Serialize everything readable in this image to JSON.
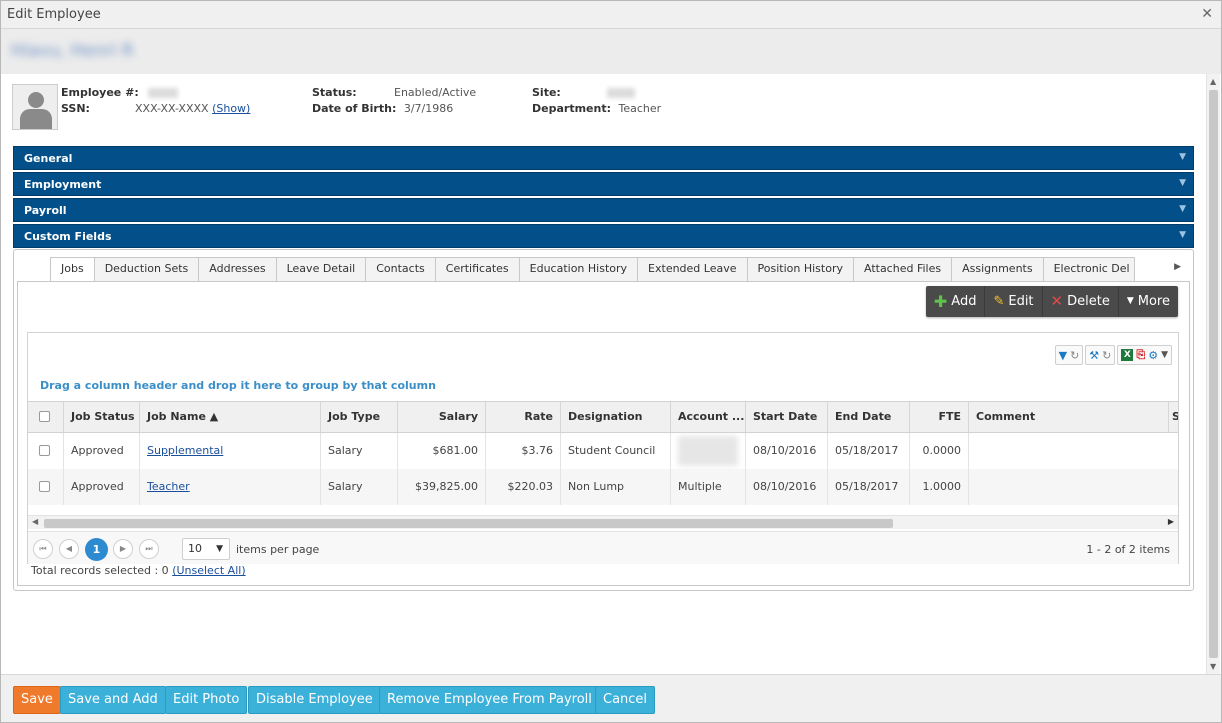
{
  "window": {
    "title": "Edit Employee",
    "employee_name": "Hiavu, Henri R"
  },
  "header": {
    "employee_num_label": "Employee #:",
    "ssn_label": "SSN:",
    "ssn_value": "XXX-XX-XXXX",
    "ssn_show": "(Show)",
    "status_label": "Status:",
    "status_value": "Enabled/Active",
    "dob_label": "Date of Birth:",
    "dob_value": "3/7/1986",
    "site_label": "Site:",
    "department_label": "Department:",
    "department_value": "Teacher"
  },
  "sections": [
    "General",
    "Employment",
    "Payroll",
    "Custom Fields"
  ],
  "tabs": [
    "Jobs",
    "Deduction Sets",
    "Addresses",
    "Leave Detail",
    "Contacts",
    "Certificates",
    "Education History",
    "Extended Leave",
    "Position History",
    "Attached Files",
    "Assignments",
    "Electronic Del"
  ],
  "toolbar": {
    "add": "Add",
    "edit": "Edit",
    "delete": "Delete",
    "more": "More"
  },
  "grid": {
    "group_hint": "Drag a column header and drop it here to group by that column",
    "columns": [
      "Job Status",
      "Job Name ▲",
      "Job Type",
      "Salary",
      "Rate",
      "Designation",
      "Account ...",
      "Start Date",
      "End Date",
      "FTE",
      "Comment",
      "S"
    ],
    "rows": [
      {
        "job_status": "Approved",
        "job_name": "Supplemental",
        "job_type": "Salary",
        "salary": "$681.00",
        "rate": "$3.76",
        "designation": "Student Council",
        "account": "",
        "start_date": "08/10/2016",
        "end_date": "05/18/2017",
        "fte": "0.0000",
        "comment": ""
      },
      {
        "job_status": "Approved",
        "job_name": "Teacher",
        "job_type": "Salary",
        "salary": "$39,825.00",
        "rate": "$220.03",
        "designation": "Non Lump",
        "account": "Multiple",
        "start_date": "08/10/2016",
        "end_date": "05/18/2017",
        "fte": "1.0000",
        "comment": ""
      }
    ],
    "pager": {
      "current_page": "1",
      "page_size": "10",
      "items_per_page": "items per page",
      "info": "1 - 2 of 2 items"
    },
    "total_selected": "Total records selected : 0",
    "unselect_all": "(Unselect All)"
  },
  "footer": {
    "save": "Save",
    "save_and_add": "Save and Add",
    "edit_photo": "Edit Photo",
    "disable_employee": "Disable Employee",
    "remove_from_payroll": "Remove Employee From Payroll",
    "cancel": "Cancel"
  }
}
